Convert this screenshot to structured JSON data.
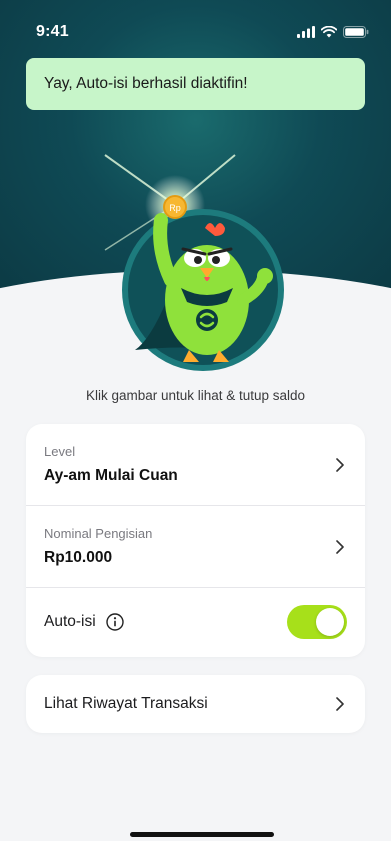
{
  "status_bar": {
    "time": "9:41"
  },
  "toast": {
    "message": "Yay, Auto-isi berhasil diaktifin!"
  },
  "mascot": {
    "coin_label": "Rp"
  },
  "caption": "Klik gambar untuk lihat & tutup saldo",
  "settings": {
    "level": {
      "label": "Level",
      "value": "Ay-am Mulai Cuan"
    },
    "nominal": {
      "label": "Nominal Pengisian",
      "value": "Rp10.000"
    },
    "auto_isi": {
      "label": "Auto-isi",
      "enabled": true
    }
  },
  "history": {
    "label": "Lihat Riwayat Transaksi"
  },
  "colors": {
    "hero": "#0f4a55",
    "toast_bg": "#c7f5c9",
    "toggle_on": "#a7e01a",
    "mascot_green": "#8fe13b"
  }
}
